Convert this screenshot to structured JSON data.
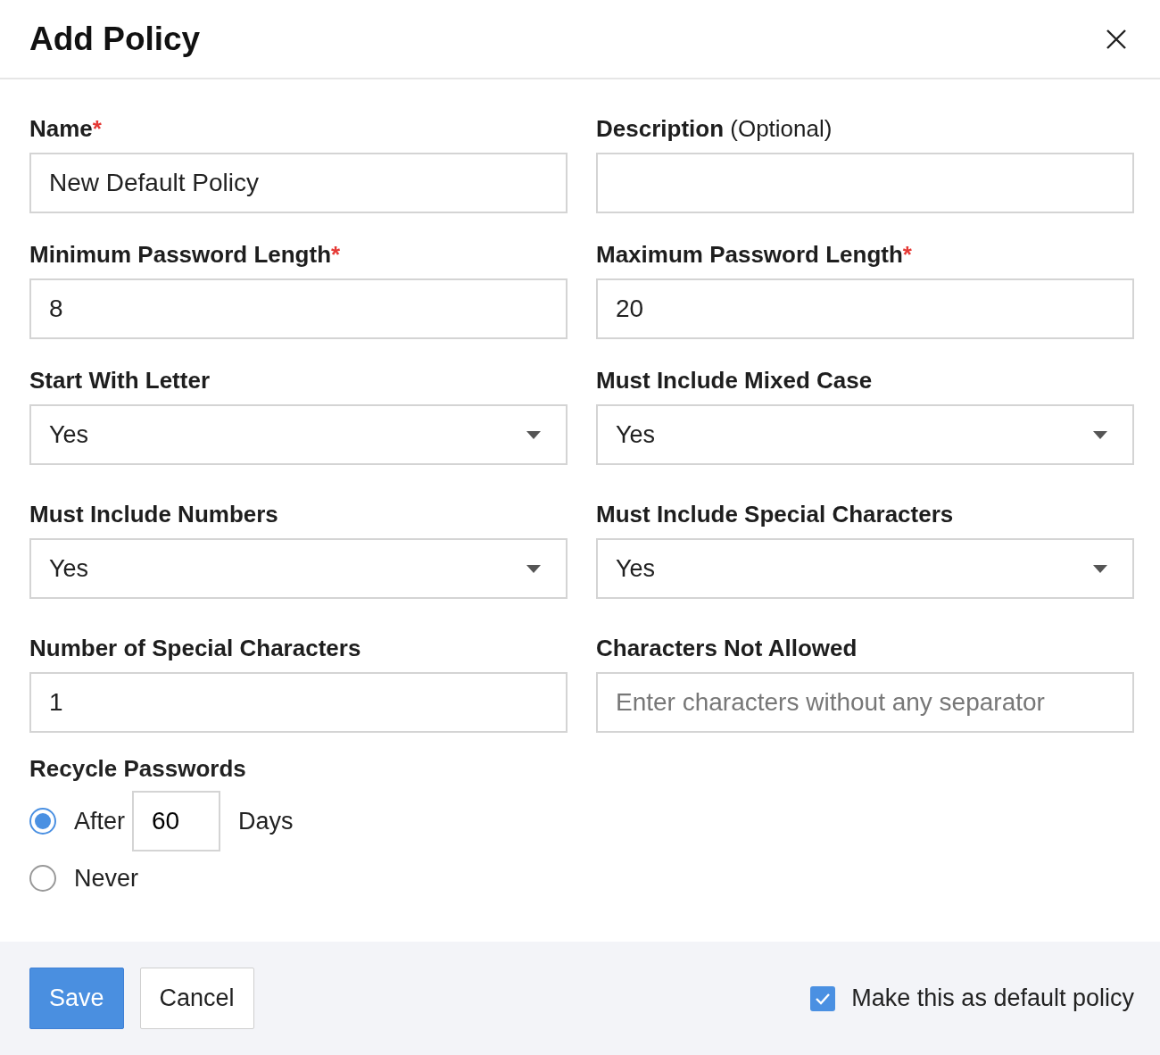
{
  "dialog": {
    "title": "Add Policy"
  },
  "fields": [
    {
      "kind": "text",
      "label": "Name",
      "required_mark": "*",
      "value": "New Default Policy"
    },
    {
      "kind": "text",
      "label": "Description",
      "hint": "(Optional)"
    },
    {
      "kind": "text",
      "label": "Minimum Password Length",
      "required_mark": "*",
      "value": "8"
    },
    {
      "kind": "text",
      "label": "Maximum Password Length",
      "required_mark": "*",
      "value": "20"
    },
    {
      "kind": "select",
      "label": "Start With Letter",
      "value": "Yes"
    },
    {
      "kind": "select",
      "label": "Must Include Mixed Case",
      "value": "Yes"
    },
    {
      "kind": "select",
      "label": "Must Include Numbers",
      "value": "Yes"
    },
    {
      "kind": "select",
      "label": "Must Include Special Characters",
      "value": "Yes"
    },
    {
      "kind": "text",
      "label": "Number of Special Characters",
      "value": "1"
    },
    {
      "kind": "text",
      "label": "Characters Not Allowed",
      "placeholder": "Enter characters without any separator"
    }
  ],
  "recycle": {
    "label": "Recycle Passwords",
    "options": [
      {
        "label": "After",
        "selected": true,
        "value": "60",
        "suffix": "Days"
      },
      {
        "label": "Never",
        "selected": false
      }
    ]
  },
  "footer": {
    "buttons": [
      {
        "label": "Save",
        "kind": "primary"
      },
      {
        "label": "Cancel",
        "kind": "secondary"
      }
    ],
    "default_policy": {
      "label": "Make this as default policy",
      "checked": true
    }
  }
}
